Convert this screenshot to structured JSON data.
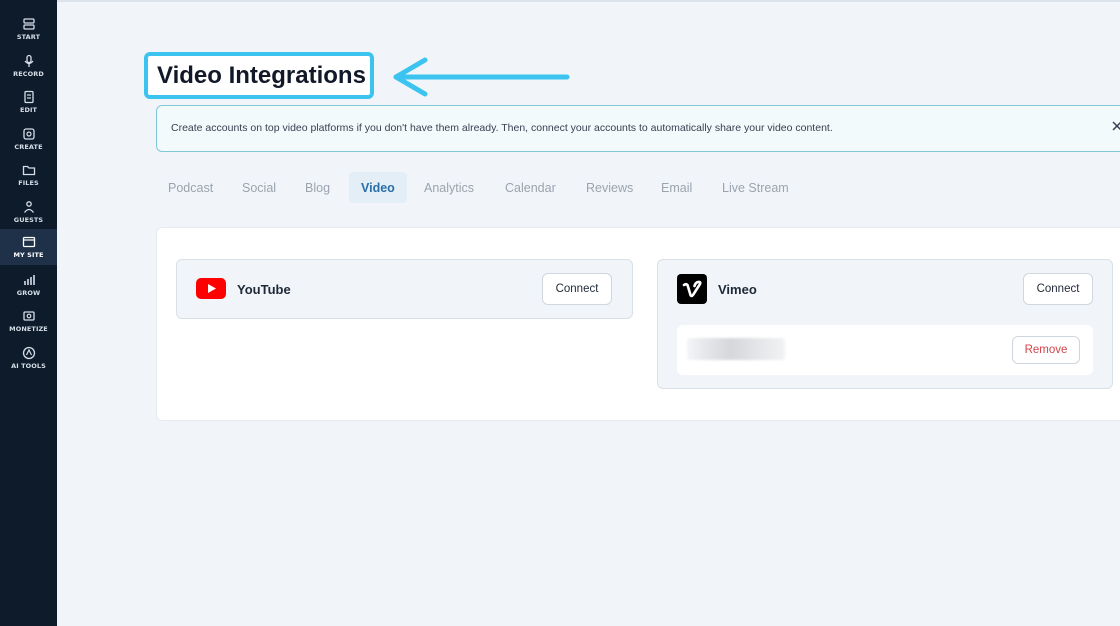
{
  "sidebar": {
    "items": [
      {
        "label": "START"
      },
      {
        "label": "RECORD"
      },
      {
        "label": "EDIT"
      },
      {
        "label": "CREATE"
      },
      {
        "label": "FILES"
      },
      {
        "label": "GUESTS"
      },
      {
        "label": "MY SITE",
        "active": true
      },
      {
        "label": "GROW"
      },
      {
        "label": "MONETIZE"
      },
      {
        "label": "AI TOOLS"
      }
    ]
  },
  "page": {
    "title": "Video Integrations",
    "highlight_color": "#3cc3ef"
  },
  "banner": {
    "text": "Create accounts on top video platforms if you don't have them already. Then, connect your accounts to automatically share your video content."
  },
  "tabs": [
    {
      "label": "Podcast"
    },
    {
      "label": "Social"
    },
    {
      "label": "Blog"
    },
    {
      "label": "Video",
      "active": true
    },
    {
      "label": "Analytics"
    },
    {
      "label": "Calendar"
    },
    {
      "label": "Reviews"
    },
    {
      "label": "Email"
    },
    {
      "label": "Live Stream"
    }
  ],
  "integrations": {
    "youtube": {
      "name": "YouTube",
      "connect_label": "Connect",
      "brand_color": "#ff0000"
    },
    "vimeo": {
      "name": "Vimeo",
      "connect_label": "Connect",
      "brand_color": "#000000",
      "remove_label": "Remove"
    }
  }
}
